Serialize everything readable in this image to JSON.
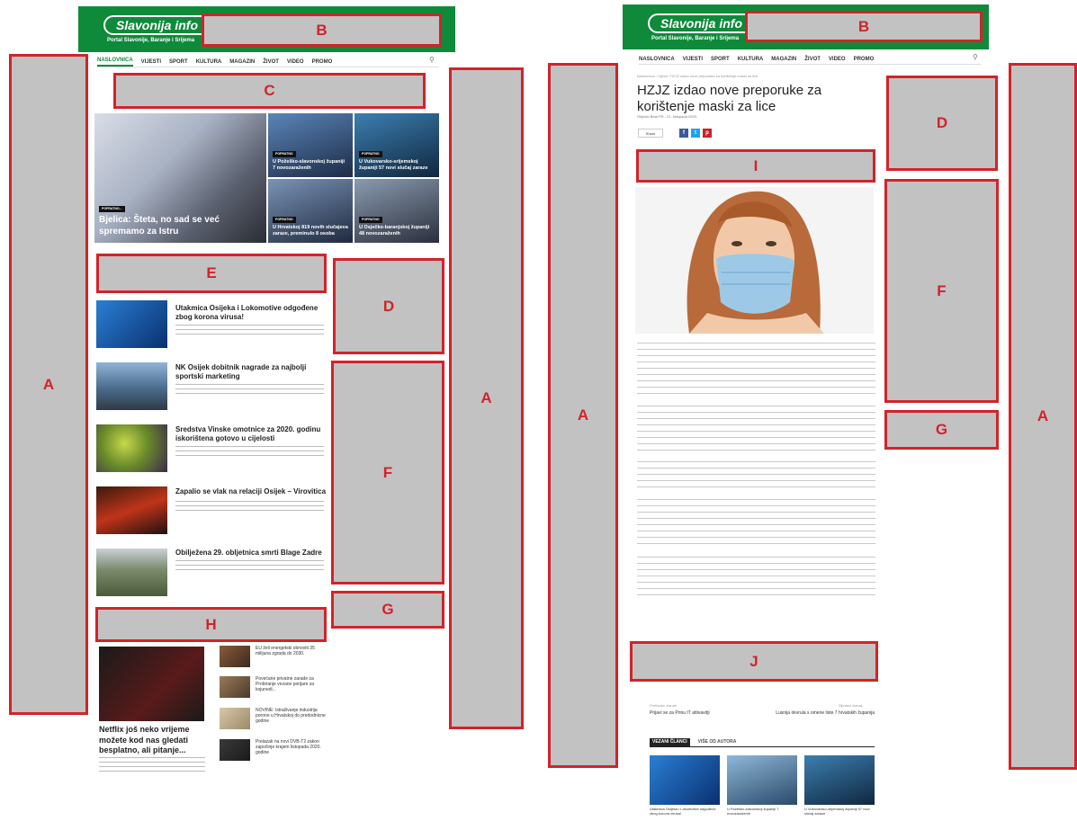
{
  "brand": {
    "logo": "Slavonija info",
    "tagline": "Portal Slavonije, Baranje i Srijema",
    "color": "#0f8a3a"
  },
  "nav": [
    "NASLOVNICA",
    "VIJESTI",
    "SPORT",
    "KULTURA",
    "MAGAZIN",
    "ŽIVOT",
    "VIDEO",
    "PROMO"
  ],
  "zone_labels": {
    "A": "A",
    "B": "B",
    "C": "C",
    "D": "D",
    "E": "E",
    "F": "F",
    "G": "G",
    "H": "H",
    "I": "I",
    "J": "J"
  },
  "left": {
    "hero": {
      "badge": "POPRATNO...",
      "title": "Bjelica: Šteta, no sad se već spremamo za Istru"
    },
    "tiles": [
      {
        "title": "U Požeško-slavonskoj županiji 7 novozaraženih"
      },
      {
        "title": "U Vukovarsko-srijemskoj županiji 57 novi slučaj zaraze"
      },
      {
        "title": "U Hrvatskoj 819 novih slučajeva zaraze, preminulo 8 osoba"
      },
      {
        "title": "U Osječko-baranjskoj županiji 48 novozaraženih"
      }
    ],
    "posts": [
      {
        "title": "Utakmica Osijeka i Lokomotive odgođene zbog korona virusa!"
      },
      {
        "title": "NK Osijek dobitnik nagrade za najbolji sportski marketing"
      },
      {
        "title": "Sredstva Vinske omotnice za 2020. godinu iskorištena gotovo u cijelosti"
      },
      {
        "title": "Zapalio se vlak na relaciji Osijek – Virovitica"
      },
      {
        "title": "Obilježena 29. obljetnica smrti Blage Zadre"
      }
    ],
    "feature": {
      "title": "Netflix još neko vrijeme možete kod nas gledati besplatno, ali pitanje..."
    },
    "side_list": [
      "EU želi energetski obnoviti 35 milijuna zgrada do 2030.",
      "Povećane privatne zarade za Probiranje vezane porijare za kojunedi...",
      "NOVINE: Istraživanje industrija porono u Hrvatskoj do predodnicne godine",
      "Prelazak na novi DVB-T2 zakon započinje krajem listopada 2020. godine"
    ]
  },
  "right": {
    "breadcrumb": "Naslovnica  ›  Vijesti  ›  HZJZ izdao nove preporuke za korištenje maski za lice",
    "title": "HZJZ izdao nove preporuke za korištenje maski za lice",
    "meta": "Objavio Beta PR  -  21. listopada 2020.",
    "share": "Share",
    "prev_label": "Prethodni članak",
    "prev": "Prijavi se za Prinu IT attivavdji",
    "next_label": "Sljedeći članak",
    "next": "Lusnija okvrula s omene liste 7 hrvatskih županija",
    "tabs": [
      "VEZANI ČLANCI",
      "VIŠE OD AUTORA"
    ],
    "related": [
      "Utakmica Osijeka i Lokomotive odgođene zbog korona virusa!",
      "U Požeško-slavonskoj županiji 7 novozaraženih",
      "U Vukovarsko-srijemskoj županiji 57 novi slučaj zaraze"
    ]
  }
}
